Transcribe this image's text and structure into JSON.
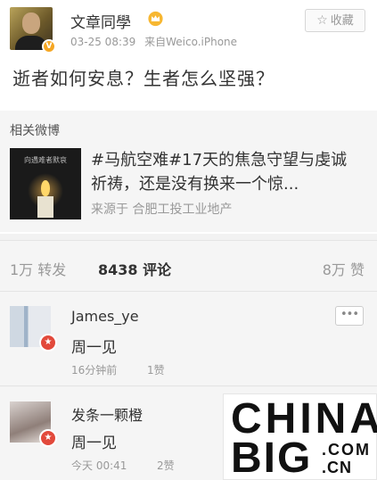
{
  "post": {
    "author": "文章同學",
    "verified_mark": "V",
    "date": "03-25 08:39",
    "source": "来自Weico.iPhone",
    "favorite_icon": "star-outline-icon",
    "favorite_label": "收藏",
    "text": "逝者如何安息？生者怎么坚强？"
  },
  "related": {
    "title": "相关微博",
    "thumbnail_caption": "向遇难者默哀",
    "headline": "#马航空难#17天的焦急守望与虔诚祈祷，还是没有换来一个惊...",
    "source": "来源于 合肥工投工业地产"
  },
  "stats": {
    "reposts": "1万 转发",
    "comments": "8438 评论",
    "likes": "8万 赞"
  },
  "comments": [
    {
      "name": "James_ye",
      "badge": "★",
      "text": "周一见",
      "time": "16分钟前",
      "likes": "1赞",
      "more_label": "•••"
    },
    {
      "name": "发条一颗橙",
      "badge": "★",
      "text": "周一见",
      "time": "今天 00:41",
      "likes": "2赞"
    }
  ],
  "watermark": {
    "line1": "CHINA",
    "line2": "BIG",
    "com": ".COM",
    "cn": ".CN"
  },
  "colors": {
    "badge_verified": "#f5a623",
    "badge_member": "#e2493b",
    "text_muted": "#999999"
  }
}
